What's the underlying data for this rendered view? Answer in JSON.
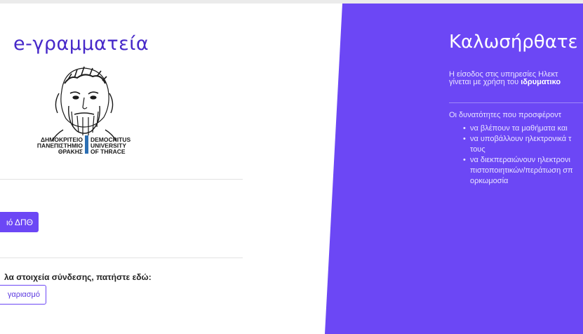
{
  "login": {
    "app_title": "e-γραμματεία",
    "logo": {
      "alt": "Democritus University of Thrace logo",
      "text_gr": [
        "ΔΗΜΟΚΡΙΤΕΙΟ",
        "ΠΑΝΕΠΙΣΤΗΜΙΟ",
        "ΘΡΑΚΗΣ"
      ],
      "text_en": [
        "DEMOCRITUS",
        "UNIVERSITY",
        "OF THRACE"
      ]
    },
    "login_button": "ιό ΔΠΘ",
    "alt_credentials_text": "λα στοιχεία σύνδεσης, πατήστε εδώ:",
    "reset_button": "γαριασμό"
  },
  "welcome": {
    "title": "Καλωσήρθατε",
    "intro_line1": "Η είσοδος στις υπηρεσίες Ηλεκτ",
    "intro_line2_prefix": "γίνεται με χρήση του ",
    "intro_line2_bold": "ιδρυματικο",
    "features_intro": "Οι δυνατότητες που προσφέροντ",
    "features": [
      "να βλέπουν τα μαθήματα και",
      "να υποβάλλουν ηλεκτρονικά τ",
      "τους",
      "να διεκπεραιώνουν ηλεκτρονι",
      "πιστοποιητικών/περάτωση σπ",
      "ορκωμοσία"
    ]
  },
  "colors": {
    "accent": "#6c47f5",
    "title": "#4628c9",
    "panel": "#6c47f5"
  }
}
